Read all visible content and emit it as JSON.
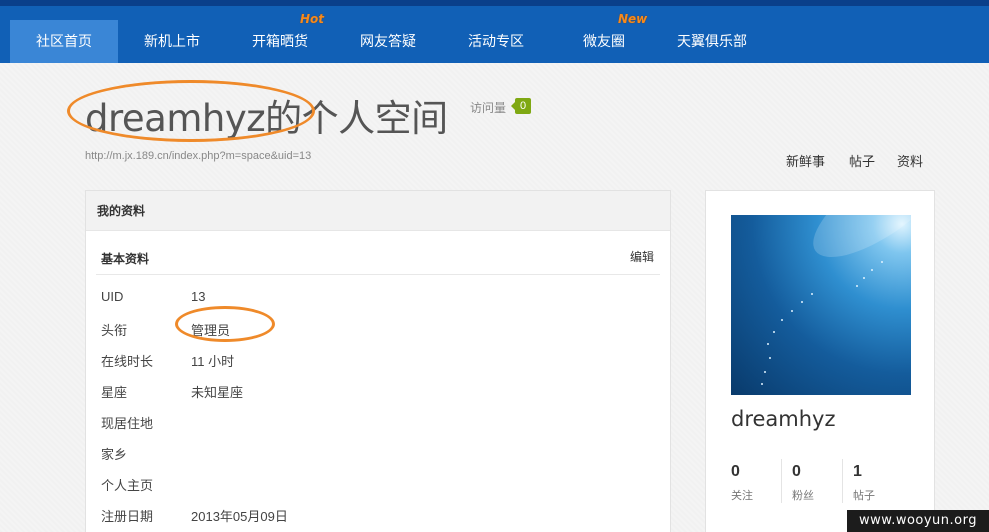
{
  "nav": {
    "items": [
      {
        "label": "社区首页",
        "active": true
      },
      {
        "label": "新机上市"
      },
      {
        "label": "开箱晒货",
        "badge": "Hot"
      },
      {
        "label": "网友答疑"
      },
      {
        "label": "活动专区"
      },
      {
        "label": "微友圈",
        "badge": "New"
      },
      {
        "label": "天翼俱乐部"
      }
    ]
  },
  "header": {
    "title": "dreamhyz的个人空间",
    "visits_label": "访问量",
    "visits_count": "0",
    "url": "http://m.jx.189.cn/index.php?m=space&uid=13"
  },
  "sub_nav": [
    "新鲜事",
    "帖子",
    "资料"
  ],
  "profile_panel": {
    "heading": "我的资料",
    "section_title": "基本资料",
    "edit_label": "编辑",
    "fields": [
      {
        "label": "UID",
        "value": "13"
      },
      {
        "label": "头衔",
        "value": "管理员"
      },
      {
        "label": "在线时长",
        "value": "11 小时"
      },
      {
        "label": "星座",
        "value": "未知星座"
      },
      {
        "label": "现居住地",
        "value": ""
      },
      {
        "label": "家乡",
        "value": ""
      },
      {
        "label": "个人主页",
        "value": ""
      },
      {
        "label": "注册日期",
        "value": "2013年05月09日"
      }
    ]
  },
  "side_panel": {
    "username": "dreamhyz",
    "stats": [
      {
        "value": "0",
        "label": "关注"
      },
      {
        "value": "0",
        "label": "粉丝"
      },
      {
        "value": "1",
        "label": "帖子"
      }
    ]
  },
  "watermark": "www.wooyun.org",
  "colors": {
    "nav_bg": "#1160b6",
    "nav_active": "#3a86d6",
    "badge": "#f58a1e",
    "annotation": "#ef8a2a",
    "visits_badge": "#7fa813"
  }
}
